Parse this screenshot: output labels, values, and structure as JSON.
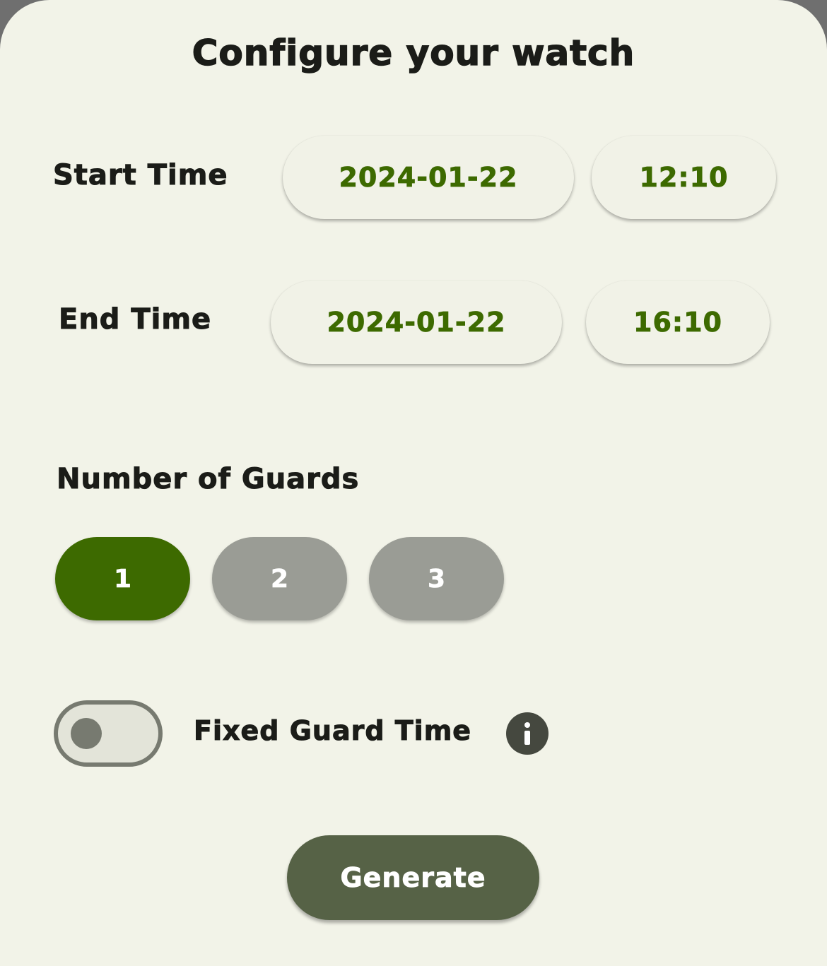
{
  "header": {
    "title": "Configure your watch"
  },
  "start_time": {
    "label": "Start Time",
    "date": "2024-01-22",
    "time": "12:10"
  },
  "end_time": {
    "label": "End Time",
    "date": "2024-01-22",
    "time": "16:10"
  },
  "guards": {
    "label": "Number of Guards",
    "options": [
      {
        "label": "1",
        "selected": true
      },
      {
        "label": "2",
        "selected": false
      },
      {
        "label": "3",
        "selected": false
      }
    ]
  },
  "fixed_guard_time": {
    "label": "Fixed Guard Time",
    "enabled": false,
    "info_icon": "info-icon"
  },
  "actions": {
    "generate_label": "Generate"
  },
  "colors": {
    "background": "#f2f3e8",
    "accent": "#3d6a00",
    "inactive": "#9a9c95",
    "button": "#566246",
    "text": "#1b1c18"
  }
}
